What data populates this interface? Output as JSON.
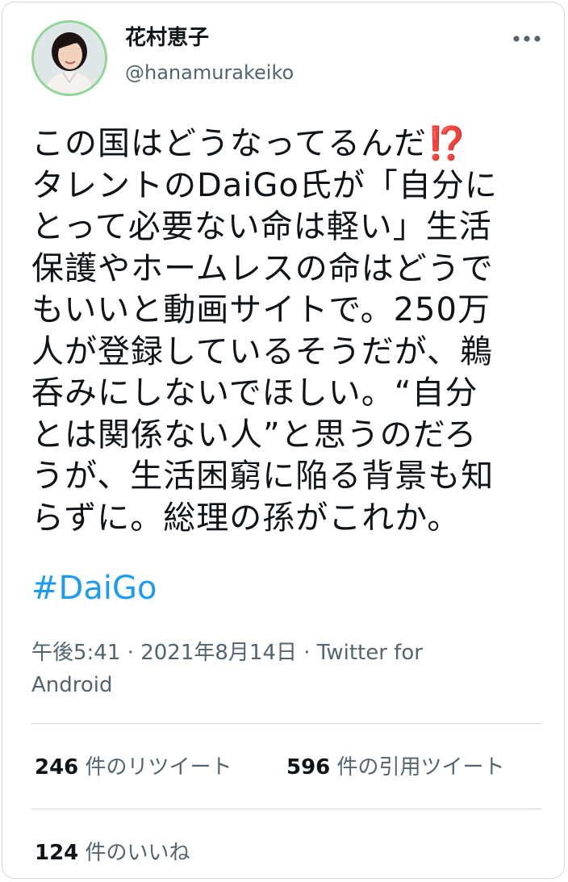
{
  "user": {
    "display_name": "花村恵子",
    "handle": "@hanamurakeiko",
    "avatar": "profile-photo"
  },
  "tweet": {
    "lines": [
      "この国はどうなってるんだ",
      "タレントのDaiGo氏が「自分に",
      "とって必要ない命は軽い」生活",
      "保護やホームレスの命はどうで",
      "もいいと動画サイトで。250万",
      "人が登録しているそうだが、鵜",
      "呑みにしないでほしい。“自分",
      "とは関係ない人”と思うのだろ",
      "うが、生活困窮に陥る背景も知",
      "らずに。総理の孫がこれか。"
    ],
    "emoji": "⁉️",
    "hashtag": "#DaiGo"
  },
  "meta": {
    "time": "午後5:41",
    "sep1": " · ",
    "date": "2021年8月14日",
    "sep2": " · ",
    "source": "Twitter for Android"
  },
  "stats": {
    "retweets_count": "246",
    "retweets_label": " 件のリツイート",
    "quotes_count": "596",
    "quotes_label": " 件の引用ツイート",
    "likes_count": "124",
    "likes_label": " 件のいいね"
  },
  "icons": {
    "more": "more-horizontal-icon"
  },
  "colors": {
    "link": "#1d9bf0",
    "secondary_text": "#536471",
    "border": "#cfd9de",
    "avatar_ring": "#8fd694",
    "emoji": "#e0245e"
  }
}
